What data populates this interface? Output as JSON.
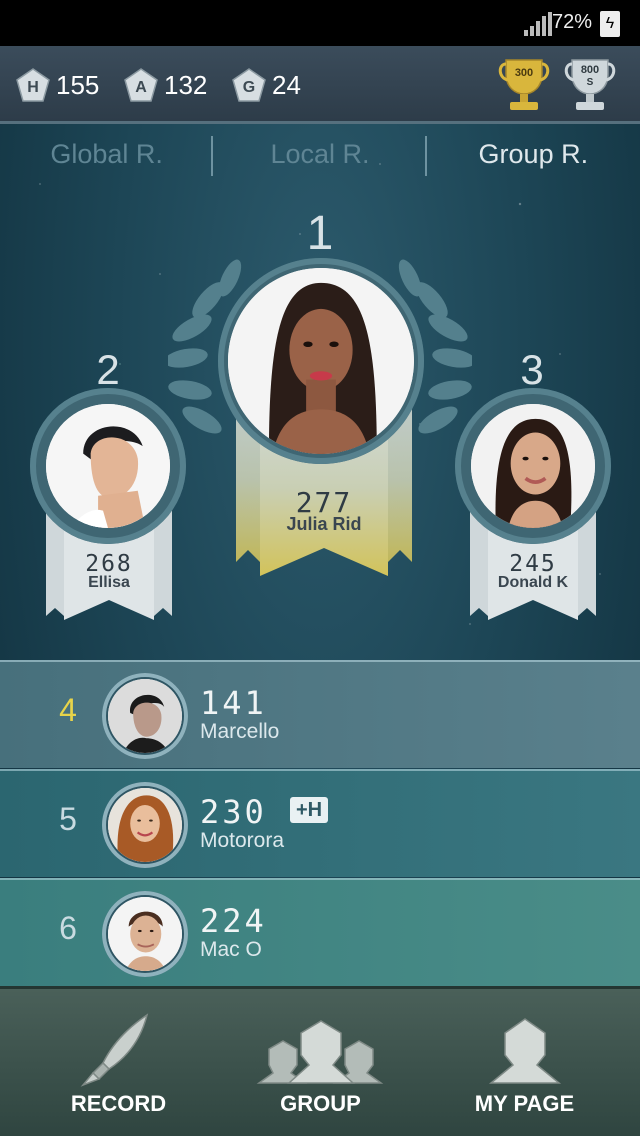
{
  "status_bar": {
    "battery": "72%"
  },
  "header": {
    "currencies": [
      {
        "letter": "H",
        "value": "155"
      },
      {
        "letter": "A",
        "value": "132"
      },
      {
        "letter": "G",
        "value": "24"
      }
    ],
    "trophies": [
      {
        "label": "300",
        "color": "#d9b63c"
      },
      {
        "label": "800",
        "sublabel": "S",
        "color": "#c9d2d6"
      }
    ]
  },
  "tabs": [
    {
      "label": "Global R.",
      "active": false
    },
    {
      "label": "Local R.",
      "active": false
    },
    {
      "label": "Group R.",
      "active": true
    }
  ],
  "podium": [
    {
      "rank": "1",
      "score": "277",
      "name": "Julia Rid"
    },
    {
      "rank": "2",
      "score": "268",
      "name": "Ellisa"
    },
    {
      "rank": "3",
      "score": "245",
      "name": "Donald K"
    }
  ],
  "list": [
    {
      "rank": "4",
      "score": "141",
      "name": "Marcello",
      "rank_color": "#e8d44a"
    },
    {
      "rank": "5",
      "score": "230",
      "name": "Motorora",
      "badge": "+H"
    },
    {
      "rank": "6",
      "score": "224",
      "name": "Mac O"
    }
  ],
  "nav": [
    {
      "label": "RECORD",
      "icon": "quill-icon"
    },
    {
      "label": "GROUP",
      "icon": "group-icon"
    },
    {
      "label": "MY PAGE",
      "icon": "person-icon"
    }
  ]
}
